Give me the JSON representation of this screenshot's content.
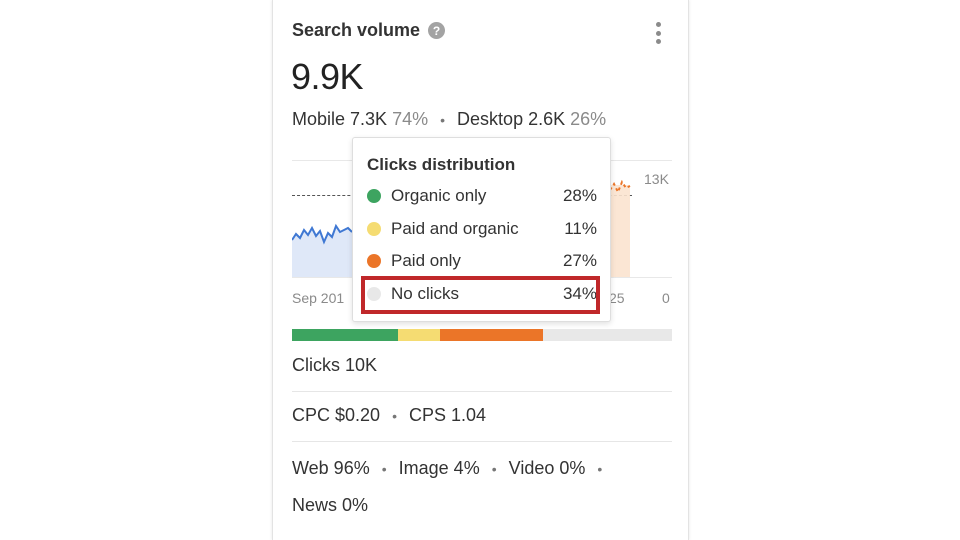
{
  "widget": {
    "title": "Search volume",
    "help_glyph": "?",
    "total_volume": "9.9K",
    "mobile_label": "Mobile 7.3K",
    "mobile_pct": "74%",
    "separator": "•",
    "desktop_label": "Desktop 2.6K",
    "desktop_pct": "26%"
  },
  "chart": {
    "y_tick_top": "13K",
    "y_tick_bottom": "0",
    "x_tick_left": "Sep 201",
    "x_tick_right": "25"
  },
  "clicks_distribution": {
    "title": "Clicks distribution",
    "items": [
      {
        "label": "Organic only",
        "pct": "28%",
        "value": 28,
        "color": "#3da460"
      },
      {
        "label": "Paid and organic",
        "pct": "11%",
        "value": 11,
        "color": "#f5dc72"
      },
      {
        "label": "Paid only",
        "pct": "27%",
        "value": 27,
        "color": "#eb7528"
      },
      {
        "label": "No clicks",
        "pct": "34%",
        "value": 34,
        "color": "#e8e8e8"
      }
    ],
    "highlight_color": "#c0282a"
  },
  "stats": {
    "clicks": "Clicks 10K",
    "cpc": "CPC $0.20",
    "cps": "CPS 1.04",
    "web": "Web 96%",
    "image": "Image 4%",
    "video": "Video 0%",
    "news": "News 0%"
  }
}
